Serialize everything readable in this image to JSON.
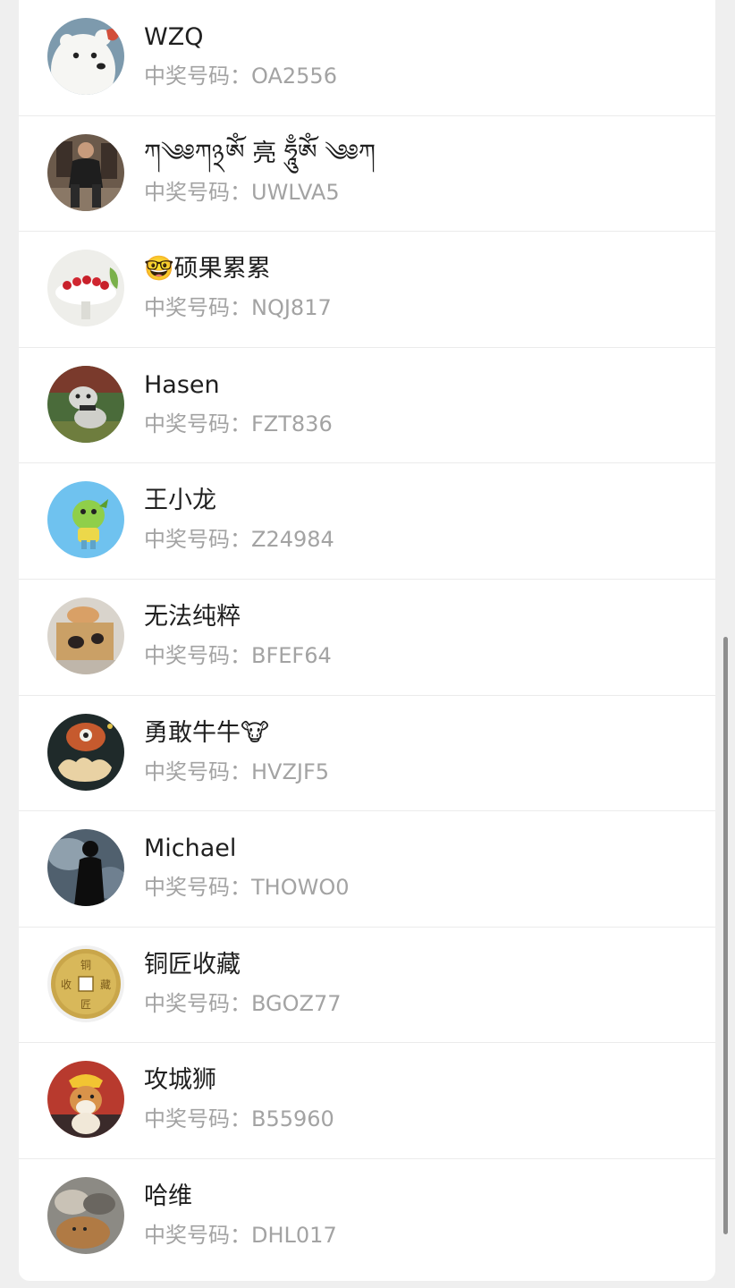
{
  "winners": {
    "code_label": "中奖号码：",
    "items": [
      {
        "name": "WZQ",
        "code": "OA2556",
        "avatar": "polar-bear-avatar"
      },
      {
        "name": "ཀ༄༅ཀ྅ཨོཾ 亮 ཧཱུྃཨོཾ ༄༅ཀ",
        "code": "UWLVA5",
        "avatar": "man-sitting-avatar"
      },
      {
        "name": "🤓硕果累累",
        "code": "NQJ817",
        "avatar": "cherry-dessert-avatar"
      },
      {
        "name": "Hasen",
        "code": "FZT836",
        "avatar": "dog-avatar"
      },
      {
        "name": "王小龙",
        "code": "Z24984",
        "avatar": "green-dragon-avatar"
      },
      {
        "name": "无法纯粹",
        "code": "BFEF64",
        "avatar": "cat-in-box-avatar"
      },
      {
        "name": "勇敢牛牛🐮",
        "code": "HVZJF5",
        "avatar": "cartoon-monster-avatar"
      },
      {
        "name": "Michael",
        "code": "THOWO0",
        "avatar": "silhouette-avatar"
      },
      {
        "name": "铜匠收藏",
        "code": "BGOZ77",
        "avatar": "copper-coin-avatar"
      },
      {
        "name": "攻城狮",
        "code": "B55960",
        "avatar": "shiba-dog-avatar"
      },
      {
        "name": "哈维",
        "code": "DHL017",
        "avatar": "cats-avatar"
      }
    ]
  },
  "coin_text": {
    "top": "铜",
    "left": "收",
    "right": "藏",
    "bottom": "匠"
  },
  "colors": {
    "background": "#efefef",
    "card": "#ffffff",
    "name_text": "#1f1f1f",
    "code_text": "#a3a3a3",
    "divider": "#ebebeb"
  }
}
